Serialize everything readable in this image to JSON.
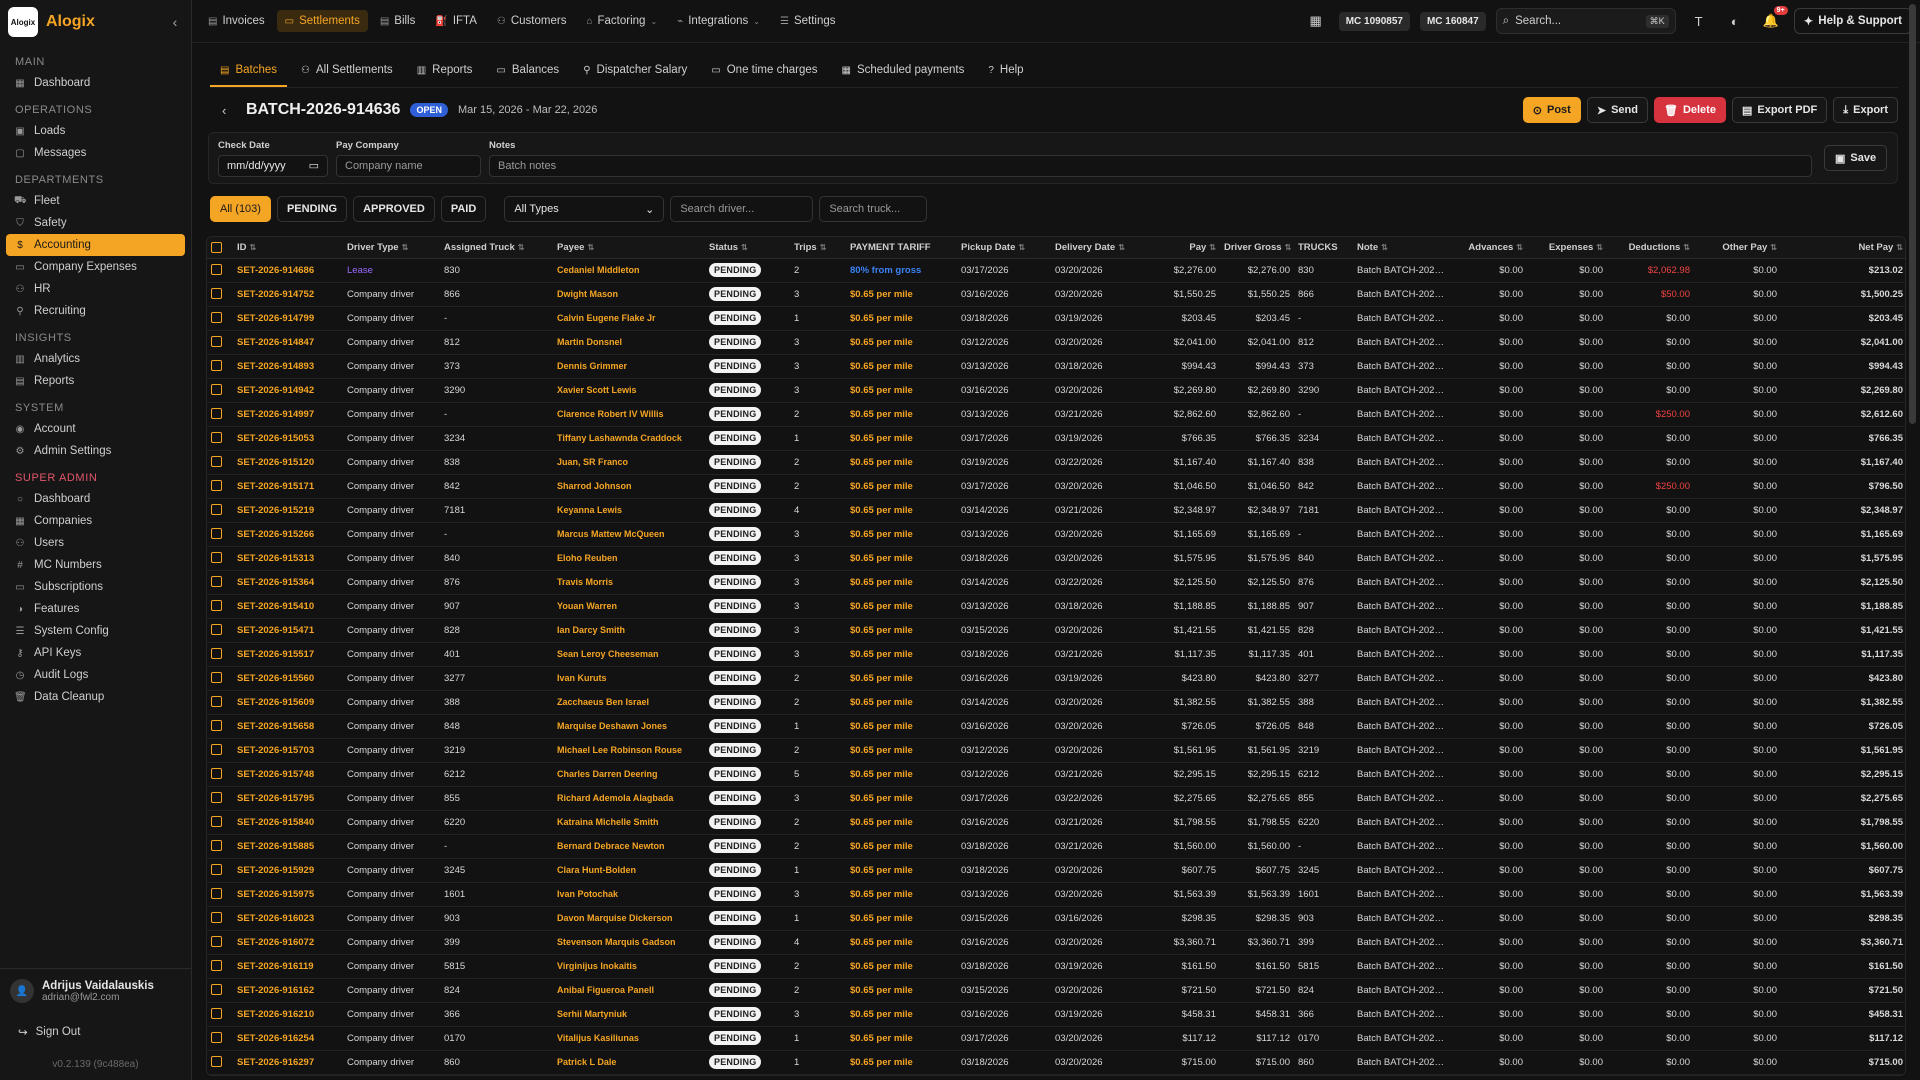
{
  "brand": {
    "name": "Alogix",
    "logo_text": "Alogix"
  },
  "sidebar": {
    "sections": [
      {
        "title": "MAIN",
        "items": [
          {
            "label": "Dashboard",
            "icon": "grid-icon"
          }
        ]
      },
      {
        "title": "OPERATIONS",
        "items": [
          {
            "label": "Loads",
            "icon": "box-icon"
          },
          {
            "label": "Messages",
            "icon": "chat-icon"
          }
        ]
      },
      {
        "title": "DEPARTMENTS",
        "items": [
          {
            "label": "Fleet",
            "icon": "truck-icon"
          },
          {
            "label": "Safety",
            "icon": "shield-icon"
          },
          {
            "label": "Accounting",
            "icon": "dollar-icon",
            "active": true
          },
          {
            "label": "Company Expenses",
            "icon": "card-icon"
          },
          {
            "label": "HR",
            "icon": "people-icon"
          },
          {
            "label": "Recruiting",
            "icon": "user-plus-icon"
          }
        ]
      },
      {
        "title": "INSIGHTS",
        "items": [
          {
            "label": "Analytics",
            "icon": "chart-icon"
          },
          {
            "label": "Reports",
            "icon": "file-icon"
          }
        ]
      },
      {
        "title": "SYSTEM",
        "items": [
          {
            "label": "Account",
            "icon": "circle-user-icon"
          },
          {
            "label": "Admin Settings",
            "icon": "gear-icon"
          }
        ]
      },
      {
        "title": "SUPER ADMIN",
        "super": true,
        "items": [
          {
            "label": "Dashboard",
            "icon": "circle-icon"
          },
          {
            "label": "Companies",
            "icon": "building-icon"
          },
          {
            "label": "Users",
            "icon": "people-icon"
          },
          {
            "label": "MC Numbers",
            "icon": "hash-icon"
          },
          {
            "label": "Subscriptions",
            "icon": "card-icon"
          },
          {
            "label": "Features",
            "icon": "toggle-icon"
          },
          {
            "label": "System Config",
            "icon": "sliders-icon"
          },
          {
            "label": "API Keys",
            "icon": "key-icon"
          },
          {
            "label": "Audit Logs",
            "icon": "clock-icon"
          },
          {
            "label": "Data Cleanup",
            "icon": "trash-icon"
          }
        ]
      }
    ],
    "user": {
      "name": "Adrijus Vaidalauskis",
      "email": "adrian@fwl2.com"
    },
    "signout": "Sign Out",
    "version": "v0.2.139 (9c488ea)"
  },
  "topnav": {
    "items": [
      {
        "label": "Invoices",
        "icon": "file-icon"
      },
      {
        "label": "Settlements",
        "icon": "card-icon",
        "active": true
      },
      {
        "label": "Bills",
        "icon": "receipt-icon"
      },
      {
        "label": "IFTA",
        "icon": "fuel-icon"
      },
      {
        "label": "Customers",
        "icon": "people-icon"
      },
      {
        "label": "Factoring",
        "icon": "bank-icon",
        "dropdown": true
      },
      {
        "label": "Integrations",
        "icon": "plug-icon",
        "dropdown": true
      },
      {
        "label": "Settings",
        "icon": "sliders-icon"
      }
    ],
    "mc_numbers": [
      "MC 1090857",
      "MC 160847"
    ],
    "search_placeholder": "Search...",
    "search_shortcut": "⌘K",
    "notif_count": "9+",
    "help": "Help & Support"
  },
  "tabs": [
    {
      "label": "Batches",
      "icon": "layers-icon",
      "active": true
    },
    {
      "label": "All Settlements",
      "icon": "people-icon"
    },
    {
      "label": "Reports",
      "icon": "chart-icon"
    },
    {
      "label": "Balances",
      "icon": "wallet-icon"
    },
    {
      "label": "Dispatcher Salary",
      "icon": "user-icon"
    },
    {
      "label": "One time charges",
      "icon": "card-icon"
    },
    {
      "label": "Scheduled payments",
      "icon": "calendar-icon"
    },
    {
      "label": "Help",
      "icon": "help-icon"
    }
  ],
  "batch": {
    "id": "BATCH-2026-914636",
    "status": "OPEN",
    "dates": "Mar 15, 2026 - Mar 22, 2026",
    "actions": {
      "post": "Post",
      "send": "Send",
      "delete": "Delete",
      "export_pdf": "Export PDF",
      "export": "Export"
    }
  },
  "form": {
    "check_date_label": "Check Date",
    "check_date_placeholder": "mm/dd/yyyy",
    "pay_company_label": "Pay Company",
    "pay_company_placeholder": "Company name",
    "notes_label": "Notes",
    "notes_placeholder": "Batch notes",
    "save": "Save"
  },
  "filters": {
    "status_tabs": [
      {
        "label": "All (103)",
        "active": true
      },
      {
        "label": "PENDING"
      },
      {
        "label": "APPROVED"
      },
      {
        "label": "PAID"
      }
    ],
    "type_select": "All Types",
    "search_driver_placeholder": "Search driver...",
    "search_truck_placeholder": "Search truck..."
  },
  "table": {
    "columns": [
      "ID",
      "Driver Type",
      "Assigned Truck",
      "Payee",
      "Status",
      "Trips",
      "PAYMENT TARIFF",
      "Pickup Date",
      "Delivery Date",
      "Pay",
      "Driver Gross",
      "TRUCKS",
      "Note",
      "Advances",
      "Expenses",
      "Deductions",
      "Other Pay",
      "Net Pay"
    ],
    "rows": [
      [
        "SET-2026-914686",
        "Lease",
        "830",
        "Cedaniel Middleton",
        "PENDING",
        "2",
        "80% from gross",
        "03/17/2026",
        "03/20/2026",
        "$2,276.00",
        "$2,276.00",
        "830",
        "Batch BATCH-2026...",
        "$0.00",
        "$0.00",
        "$2,062.98",
        "$0.00",
        "$213.02"
      ],
      [
        "SET-2026-914752",
        "Company driver",
        "866",
        "Dwight Mason",
        "PENDING",
        "3",
        "$0.65 per mile",
        "03/16/2026",
        "03/20/2026",
        "$1,550.25",
        "$1,550.25",
        "866",
        "Batch BATCH-2026...",
        "$0.00",
        "$0.00",
        "$50.00",
        "$0.00",
        "$1,500.25"
      ],
      [
        "SET-2026-914799",
        "Company driver",
        "-",
        "Calvin Eugene Flake Jr",
        "PENDING",
        "1",
        "$0.65 per mile",
        "03/18/2026",
        "03/19/2026",
        "$203.45",
        "$203.45",
        "-",
        "Batch BATCH-2026...",
        "$0.00",
        "$0.00",
        "$0.00",
        "$0.00",
        "$203.45"
      ],
      [
        "SET-2026-914847",
        "Company driver",
        "812",
        "Martin Donsnel",
        "PENDING",
        "3",
        "$0.65 per mile",
        "03/12/2026",
        "03/20/2026",
        "$2,041.00",
        "$2,041.00",
        "812",
        "Batch BATCH-2026...",
        "$0.00",
        "$0.00",
        "$0.00",
        "$0.00",
        "$2,041.00"
      ],
      [
        "SET-2026-914893",
        "Company driver",
        "373",
        "Dennis Grimmer",
        "PENDING",
        "3",
        "$0.65 per mile",
        "03/13/2026",
        "03/18/2026",
        "$994.43",
        "$994.43",
        "373",
        "Batch BATCH-2026...",
        "$0.00",
        "$0.00",
        "$0.00",
        "$0.00",
        "$994.43"
      ],
      [
        "SET-2026-914942",
        "Company driver",
        "3290",
        "Xavier Scott Lewis",
        "PENDING",
        "3",
        "$0.65 per mile",
        "03/16/2026",
        "03/20/2026",
        "$2,269.80",
        "$2,269.80",
        "3290",
        "Batch BATCH-2026...",
        "$0.00",
        "$0.00",
        "$0.00",
        "$0.00",
        "$2,269.80"
      ],
      [
        "SET-2026-914997",
        "Company driver",
        "-",
        "Clarence Robert IV Willis",
        "PENDING",
        "2",
        "$0.65 per mile",
        "03/13/2026",
        "03/21/2026",
        "$2,862.60",
        "$2,862.60",
        "-",
        "Batch BATCH-2026...",
        "$0.00",
        "$0.00",
        "$250.00",
        "$0.00",
        "$2,612.60"
      ],
      [
        "SET-2026-915053",
        "Company driver",
        "3234",
        "Tiffany Lashawnda Craddock",
        "PENDING",
        "1",
        "$0.65 per mile",
        "03/17/2026",
        "03/19/2026",
        "$766.35",
        "$766.35",
        "3234",
        "Batch BATCH-2026...",
        "$0.00",
        "$0.00",
        "$0.00",
        "$0.00",
        "$766.35"
      ],
      [
        "SET-2026-915120",
        "Company driver",
        "838",
        "Juan, SR Franco",
        "PENDING",
        "2",
        "$0.65 per mile",
        "03/19/2026",
        "03/22/2026",
        "$1,167.40",
        "$1,167.40",
        "838",
        "Batch BATCH-2026...",
        "$0.00",
        "$0.00",
        "$0.00",
        "$0.00",
        "$1,167.40"
      ],
      [
        "SET-2026-915171",
        "Company driver",
        "842",
        "Sharrod Johnson",
        "PENDING",
        "2",
        "$0.65 per mile",
        "03/17/2026",
        "03/20/2026",
        "$1,046.50",
        "$1,046.50",
        "842",
        "Batch BATCH-2026...",
        "$0.00",
        "$0.00",
        "$250.00",
        "$0.00",
        "$796.50"
      ],
      [
        "SET-2026-915219",
        "Company driver",
        "7181",
        "Keyanna Lewis",
        "PENDING",
        "4",
        "$0.65 per mile",
        "03/14/2026",
        "03/21/2026",
        "$2,348.97",
        "$2,348.97",
        "7181",
        "Batch BATCH-2026...",
        "$0.00",
        "$0.00",
        "$0.00",
        "$0.00",
        "$2,348.97"
      ],
      [
        "SET-2026-915266",
        "Company driver",
        "-",
        "Marcus Mattew McQueen",
        "PENDING",
        "3",
        "$0.65 per mile",
        "03/13/2026",
        "03/20/2026",
        "$1,165.69",
        "$1,165.69",
        "-",
        "Batch BATCH-2026...",
        "$0.00",
        "$0.00",
        "$0.00",
        "$0.00",
        "$1,165.69"
      ],
      [
        "SET-2026-915313",
        "Company driver",
        "840",
        "Eloho Reuben",
        "PENDING",
        "3",
        "$0.65 per mile",
        "03/18/2026",
        "03/20/2026",
        "$1,575.95",
        "$1,575.95",
        "840",
        "Batch BATCH-2026...",
        "$0.00",
        "$0.00",
        "$0.00",
        "$0.00",
        "$1,575.95"
      ],
      [
        "SET-2026-915364",
        "Company driver",
        "876",
        "Travis Morris",
        "PENDING",
        "3",
        "$0.65 per mile",
        "03/14/2026",
        "03/22/2026",
        "$2,125.50",
        "$2,125.50",
        "876",
        "Batch BATCH-2026...",
        "$0.00",
        "$0.00",
        "$0.00",
        "$0.00",
        "$2,125.50"
      ],
      [
        "SET-2026-915410",
        "Company driver",
        "907",
        "Youan Warren",
        "PENDING",
        "3",
        "$0.65 per mile",
        "03/13/2026",
        "03/18/2026",
        "$1,188.85",
        "$1,188.85",
        "907",
        "Batch BATCH-2026...",
        "$0.00",
        "$0.00",
        "$0.00",
        "$0.00",
        "$1,188.85"
      ],
      [
        "SET-2026-915471",
        "Company driver",
        "828",
        "Ian Darcy Smith",
        "PENDING",
        "3",
        "$0.65 per mile",
        "03/15/2026",
        "03/20/2026",
        "$1,421.55",
        "$1,421.55",
        "828",
        "Batch BATCH-2026...",
        "$0.00",
        "$0.00",
        "$0.00",
        "$0.00",
        "$1,421.55"
      ],
      [
        "SET-2026-915517",
        "Company driver",
        "401",
        "Sean Leroy Cheeseman",
        "PENDING",
        "3",
        "$0.65 per mile",
        "03/18/2026",
        "03/21/2026",
        "$1,117.35",
        "$1,117.35",
        "401",
        "Batch BATCH-2026...",
        "$0.00",
        "$0.00",
        "$0.00",
        "$0.00",
        "$1,117.35"
      ],
      [
        "SET-2026-915560",
        "Company driver",
        "3277",
        "Ivan Kuruts",
        "PENDING",
        "2",
        "$0.65 per mile",
        "03/16/2026",
        "03/19/2026",
        "$423.80",
        "$423.80",
        "3277",
        "Batch BATCH-2026...",
        "$0.00",
        "$0.00",
        "$0.00",
        "$0.00",
        "$423.80"
      ],
      [
        "SET-2026-915609",
        "Company driver",
        "388",
        "Zacchaeus Ben Israel",
        "PENDING",
        "2",
        "$0.65 per mile",
        "03/14/2026",
        "03/20/2026",
        "$1,382.55",
        "$1,382.55",
        "388",
        "Batch BATCH-2026...",
        "$0.00",
        "$0.00",
        "$0.00",
        "$0.00",
        "$1,382.55"
      ],
      [
        "SET-2026-915658",
        "Company driver",
        "848",
        "Marquise Deshawn Jones",
        "PENDING",
        "1",
        "$0.65 per mile",
        "03/16/2026",
        "03/20/2026",
        "$726.05",
        "$726.05",
        "848",
        "Batch BATCH-2026...",
        "$0.00",
        "$0.00",
        "$0.00",
        "$0.00",
        "$726.05"
      ],
      [
        "SET-2026-915703",
        "Company driver",
        "3219",
        "Michael Lee Robinson Rouse",
        "PENDING",
        "2",
        "$0.65 per mile",
        "03/12/2026",
        "03/20/2026",
        "$1,561.95",
        "$1,561.95",
        "3219",
        "Batch BATCH-2026...",
        "$0.00",
        "$0.00",
        "$0.00",
        "$0.00",
        "$1,561.95"
      ],
      [
        "SET-2026-915748",
        "Company driver",
        "6212",
        "Charles Darren Deering",
        "PENDING",
        "5",
        "$0.65 per mile",
        "03/12/2026",
        "03/21/2026",
        "$2,295.15",
        "$2,295.15",
        "6212",
        "Batch BATCH-2026...",
        "$0.00",
        "$0.00",
        "$0.00",
        "$0.00",
        "$2,295.15"
      ],
      [
        "SET-2026-915795",
        "Company driver",
        "855",
        "Richard Ademola Alagbada",
        "PENDING",
        "3",
        "$0.65 per mile",
        "03/17/2026",
        "03/22/2026",
        "$2,275.65",
        "$2,275.65",
        "855",
        "Batch BATCH-2026...",
        "$0.00",
        "$0.00",
        "$0.00",
        "$0.00",
        "$2,275.65"
      ],
      [
        "SET-2026-915840",
        "Company driver",
        "6220",
        "Katraina Michelle Smith",
        "PENDING",
        "2",
        "$0.65 per mile",
        "03/16/2026",
        "03/21/2026",
        "$1,798.55",
        "$1,798.55",
        "6220",
        "Batch BATCH-2026...",
        "$0.00",
        "$0.00",
        "$0.00",
        "$0.00",
        "$1,798.55"
      ],
      [
        "SET-2026-915885",
        "Company driver",
        "-",
        "Bernard Debrace Newton",
        "PENDING",
        "2",
        "$0.65 per mile",
        "03/18/2026",
        "03/21/2026",
        "$1,560.00",
        "$1,560.00",
        "-",
        "Batch BATCH-2026...",
        "$0.00",
        "$0.00",
        "$0.00",
        "$0.00",
        "$1,560.00"
      ],
      [
        "SET-2026-915929",
        "Company driver",
        "3245",
        "Clara Hunt-Bolden",
        "PENDING",
        "1",
        "$0.65 per mile",
        "03/18/2026",
        "03/20/2026",
        "$607.75",
        "$607.75",
        "3245",
        "Batch BATCH-2026...",
        "$0.00",
        "$0.00",
        "$0.00",
        "$0.00",
        "$607.75"
      ],
      [
        "SET-2026-915975",
        "Company driver",
        "1601",
        "Ivan Potochak",
        "PENDING",
        "3",
        "$0.65 per mile",
        "03/13/2026",
        "03/20/2026",
        "$1,563.39",
        "$1,563.39",
        "1601",
        "Batch BATCH-2026...",
        "$0.00",
        "$0.00",
        "$0.00",
        "$0.00",
        "$1,563.39"
      ],
      [
        "SET-2026-916023",
        "Company driver",
        "903",
        "Davon Marquise Dickerson",
        "PENDING",
        "1",
        "$0.65 per mile",
        "03/15/2026",
        "03/16/2026",
        "$298.35",
        "$298.35",
        "903",
        "Batch BATCH-2026...",
        "$0.00",
        "$0.00",
        "$0.00",
        "$0.00",
        "$298.35"
      ],
      [
        "SET-2026-916072",
        "Company driver",
        "399",
        "Stevenson Marquis Gadson",
        "PENDING",
        "4",
        "$0.65 per mile",
        "03/16/2026",
        "03/20/2026",
        "$3,360.71",
        "$3,360.71",
        "399",
        "Batch BATCH-2026...",
        "$0.00",
        "$0.00",
        "$0.00",
        "$0.00",
        "$3,360.71"
      ],
      [
        "SET-2026-916119",
        "Company driver",
        "5815",
        "Virginijus Inokaitis",
        "PENDING",
        "2",
        "$0.65 per mile",
        "03/18/2026",
        "03/19/2026",
        "$161.50",
        "$161.50",
        "5815",
        "Batch BATCH-2026...",
        "$0.00",
        "$0.00",
        "$0.00",
        "$0.00",
        "$161.50"
      ],
      [
        "SET-2026-916162",
        "Company driver",
        "824",
        "Anibal Figueroa Panell",
        "PENDING",
        "2",
        "$0.65 per mile",
        "03/15/2026",
        "03/20/2026",
        "$721.50",
        "$721.50",
        "824",
        "Batch BATCH-2026...",
        "$0.00",
        "$0.00",
        "$0.00",
        "$0.00",
        "$721.50"
      ],
      [
        "SET-2026-916210",
        "Company driver",
        "366",
        "Serhii Martyniuk",
        "PENDING",
        "3",
        "$0.65 per mile",
        "03/16/2026",
        "03/19/2026",
        "$458.31",
        "$458.31",
        "366",
        "Batch BATCH-2026...",
        "$0.00",
        "$0.00",
        "$0.00",
        "$0.00",
        "$458.31"
      ],
      [
        "SET-2026-916254",
        "Company driver",
        "0170",
        "Vitalijus Kasiliunas",
        "PENDING",
        "1",
        "$0.65 per mile",
        "03/17/2026",
        "03/20/2026",
        "$117.12",
        "$117.12",
        "0170",
        "Batch BATCH-2026...",
        "$0.00",
        "$0.00",
        "$0.00",
        "$0.00",
        "$117.12"
      ],
      [
        "SET-2026-916297",
        "Company driver",
        "860",
        "Patrick L Dale",
        "PENDING",
        "1",
        "$0.65 per mile",
        "03/18/2026",
        "03/20/2026",
        "$715.00",
        "$715.00",
        "860",
        "Batch BATCH-2026...",
        "$0.00",
        "$0.00",
        "$0.00",
        "$0.00",
        "$715.00"
      ]
    ]
  },
  "colors": {
    "accent": "#f5a524",
    "danger": "#d6333f",
    "info": "#2f5fd6",
    "lease": "#9a6bff"
  }
}
